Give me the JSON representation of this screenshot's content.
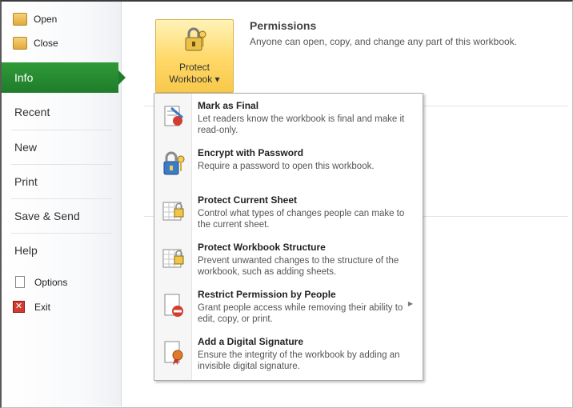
{
  "sidebar": {
    "open_label": "Open",
    "close_label": "Close",
    "info_label": "Info",
    "recent_label": "Recent",
    "new_label": "New",
    "print_label": "Print",
    "save_send_label": "Save & Send",
    "help_label": "Help",
    "options_label": "Options",
    "exit_label": "Exit"
  },
  "protect_button": {
    "line1": "Protect",
    "line2": "Workbook ▾"
  },
  "permissions": {
    "title": "Permissions",
    "description": "Anyone can open, copy, and change any part of this workbook."
  },
  "menu": {
    "items": [
      {
        "title": "Mark as Final",
        "description": "Let readers know the workbook is final and make it read-only.",
        "icon": "mark-final-icon"
      },
      {
        "title": "Encrypt with Password",
        "description": "Require a password to open this workbook.",
        "icon": "key-lock-icon"
      },
      {
        "title": "Protect Current Sheet",
        "description": "Control what types of changes people can make to the current sheet.",
        "icon": "sheet-lock-icon"
      },
      {
        "title": "Protect Workbook Structure",
        "description": "Prevent unwanted changes to the structure of the workbook, such as adding sheets.",
        "icon": "workbook-lock-icon"
      },
      {
        "title": "Restrict Permission by People",
        "description": "Grant people access while removing their ability to edit, copy, or print.",
        "icon": "restrict-icon",
        "has_submenu": true
      },
      {
        "title": "Add a Digital Signature",
        "description": "Ensure the integrity of the workbook by adding an invisible digital signature.",
        "icon": "signature-icon"
      }
    ]
  }
}
